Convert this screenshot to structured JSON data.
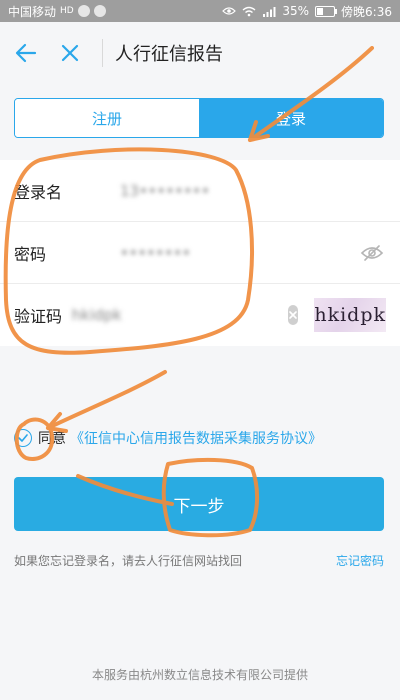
{
  "status_bar": {
    "carrier": "中国移动",
    "hd": "HD",
    "battery": "35%",
    "battery_level": 0.35,
    "time": "傍晚6:36"
  },
  "header": {
    "title": "人行征信报告"
  },
  "tabs": [
    {
      "label": "注册",
      "active": false
    },
    {
      "label": "登录",
      "active": true
    }
  ],
  "form": {
    "username": {
      "label": "登录名",
      "value": "13••••••••"
    },
    "password": {
      "label": "密码",
      "value": "••••••••"
    },
    "captcha": {
      "label": "验证码",
      "value": "hkidpk",
      "image_text": "hkidpk"
    }
  },
  "agreement": {
    "label": "同意",
    "link": "《征信中心信用报告数据采集服务协议》"
  },
  "next_button": "下一步",
  "hint": {
    "text": "如果您忘记登录名，请去人行征信网站找回",
    "forgot_password": "忘记密码"
  },
  "footer": "本服务由杭州数立信息技术有限公司提供",
  "colors": {
    "accent": "#2aa7ea",
    "annotation": "#f08c3c"
  }
}
